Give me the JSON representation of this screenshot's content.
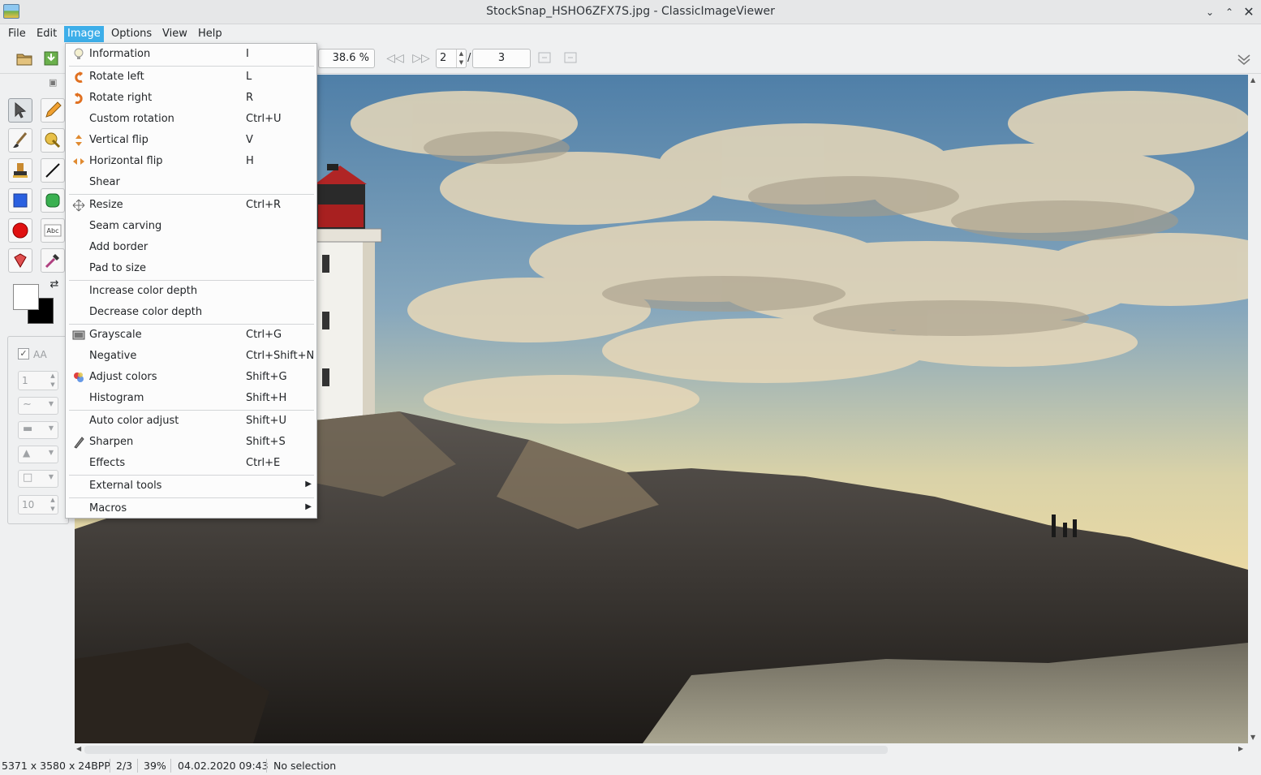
{
  "window": {
    "title": "StockSnap_HSHO6ZFX7S.jpg - ClassicImageViewer"
  },
  "menubar": {
    "file": "File",
    "edit": "Edit",
    "image": "Image",
    "options": "Options",
    "view": "View",
    "help": "Help"
  },
  "toolbar": {
    "zoom": "38.6 %",
    "page_current": "2",
    "page_sep": "/",
    "page_total": "3"
  },
  "tool_options": {
    "antialias_label": "AA",
    "line_width": "1",
    "size_value": "10"
  },
  "image_menu": {
    "items": [
      {
        "label": "Information",
        "shortcut": "I"
      },
      {
        "label": "Rotate left",
        "shortcut": "L"
      },
      {
        "label": "Rotate right",
        "shortcut": "R"
      },
      {
        "label": "Custom rotation",
        "shortcut": "Ctrl+U"
      },
      {
        "label": "Vertical flip",
        "shortcut": "V"
      },
      {
        "label": "Horizontal flip",
        "shortcut": "H"
      },
      {
        "label": "Shear",
        "shortcut": ""
      },
      {
        "label": "Resize",
        "shortcut": "Ctrl+R"
      },
      {
        "label": "Seam carving",
        "shortcut": ""
      },
      {
        "label": "Add border",
        "shortcut": ""
      },
      {
        "label": "Pad to size",
        "shortcut": ""
      },
      {
        "label": "Increase color depth",
        "shortcut": ""
      },
      {
        "label": "Decrease color depth",
        "shortcut": ""
      },
      {
        "label": "Grayscale",
        "shortcut": "Ctrl+G"
      },
      {
        "label": "Negative",
        "shortcut": "Ctrl+Shift+N"
      },
      {
        "label": "Adjust colors",
        "shortcut": "Shift+G"
      },
      {
        "label": "Histogram",
        "shortcut": "Shift+H"
      },
      {
        "label": "Auto color adjust",
        "shortcut": "Shift+U"
      },
      {
        "label": "Sharpen",
        "shortcut": "Shift+S"
      },
      {
        "label": "Effects",
        "shortcut": "Ctrl+E"
      },
      {
        "label": "External tools",
        "shortcut": ""
      },
      {
        "label": "Macros",
        "shortcut": ""
      }
    ]
  },
  "statusbar": {
    "dimensions": "5371 x 3580 x 24BPP",
    "page": "2/3",
    "zoom": "39%",
    "datetime": "04.02.2020 09:43",
    "selection": "No selection"
  },
  "colors": {
    "accent": "#3daee9",
    "primary_color": "#ffffff",
    "secondary_color": "#000000"
  }
}
